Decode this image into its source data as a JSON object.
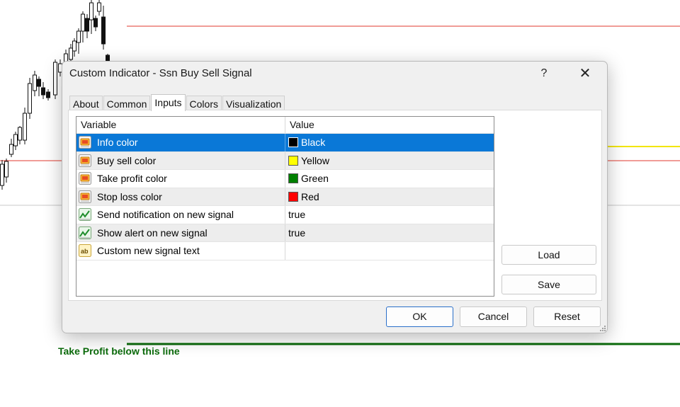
{
  "chart_overlay": {
    "take_profit_label": "Take Profit below this line",
    "colors": {
      "red_line": "#e03a2f",
      "yellow_line": "#f2e600",
      "green_line": "#0b6b0b",
      "grey_line": "#c8c8c8",
      "candle": "#111111"
    }
  },
  "dialog": {
    "title": "Custom Indicator - Ssn Buy Sell Signal",
    "help_label": "?",
    "close_label": "✕",
    "tabs": [
      {
        "label": "About",
        "active": false
      },
      {
        "label": "Common",
        "active": false
      },
      {
        "label": "Inputs",
        "active": true
      },
      {
        "label": "Colors",
        "active": false
      },
      {
        "label": "Visualization",
        "active": false
      }
    ],
    "table": {
      "headers": {
        "variable": "Variable",
        "value": "Value"
      },
      "rows": [
        {
          "variable": "Info color",
          "value": "Black",
          "swatch": "#000000",
          "icon": "color-param-icon",
          "selected": true
        },
        {
          "variable": "Buy sell color",
          "value": "Yellow",
          "swatch": "#ffff00",
          "icon": "color-param-icon"
        },
        {
          "variable": "Take profit color",
          "value": "Green",
          "swatch": "#008000",
          "icon": "color-param-icon"
        },
        {
          "variable": "Stop loss color",
          "value": "Red",
          "swatch": "#ff0000",
          "icon": "color-param-icon"
        },
        {
          "variable": "Send notification on new signal",
          "value": "true",
          "icon": "bool-param-icon"
        },
        {
          "variable": "Show alert on new signal",
          "value": "true",
          "icon": "bool-param-icon"
        },
        {
          "variable": "Custom new signal text",
          "value": "",
          "icon": "string-param-icon"
        }
      ]
    },
    "buttons": {
      "load": "Load",
      "save": "Save",
      "ok": "OK",
      "cancel": "Cancel",
      "reset": "Reset"
    },
    "accent_color": "#0a78d7"
  }
}
